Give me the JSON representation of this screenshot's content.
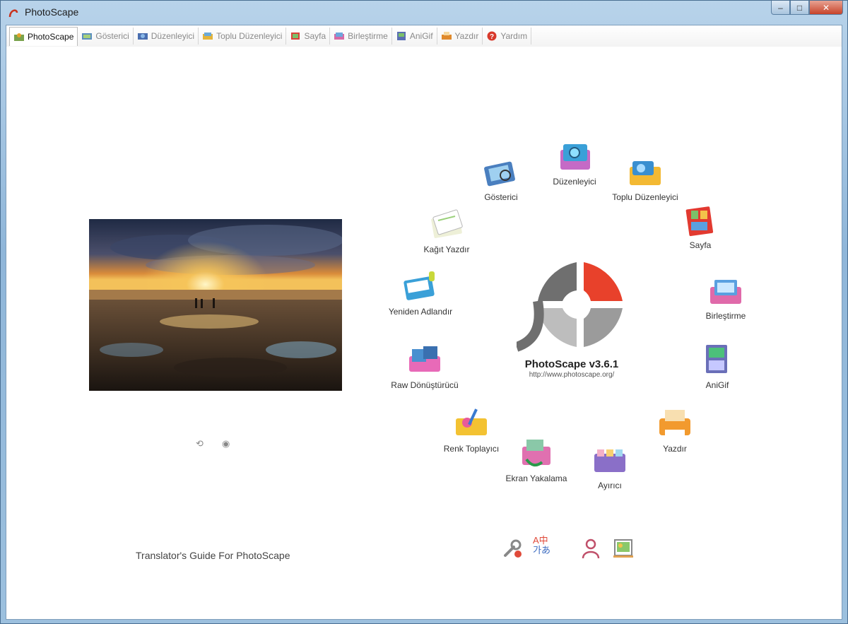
{
  "window": {
    "title": "PhotoScape",
    "controls": {
      "minimize": "–",
      "maximize": "□",
      "close": "✕"
    }
  },
  "tabs": [
    {
      "label": "PhotoScape",
      "active": true,
      "icon": "photoscape-icon"
    },
    {
      "label": "Gösterici",
      "active": false,
      "icon": "viewer-icon"
    },
    {
      "label": "Düzenleyici",
      "active": false,
      "icon": "editor-icon"
    },
    {
      "label": "Toplu Düzenleyici",
      "active": false,
      "icon": "batch-editor-icon"
    },
    {
      "label": "Sayfa",
      "active": false,
      "icon": "page-icon"
    },
    {
      "label": "Birleştirme",
      "active": false,
      "icon": "combine-icon"
    },
    {
      "label": "AniGif",
      "active": false,
      "icon": "anigif-icon"
    },
    {
      "label": "Yazdır",
      "active": false,
      "icon": "print-icon"
    },
    {
      "label": "Yardım",
      "active": false,
      "icon": "help-icon"
    }
  ],
  "brand": {
    "name": "PhotoScape v3.6.1",
    "url": "http://www.photoscape.org/"
  },
  "tools": {
    "gosterici": "Gösterici",
    "duzenleyici": "Düzenleyici",
    "toplu": "Toplu Düzenleyici",
    "sayfa": "Sayfa",
    "birlestirme": "Birleştirme",
    "anigif": "AniGif",
    "yazdir": "Yazdır",
    "ayirici": "Ayırıcı",
    "ekran": "Ekran Yakalama",
    "renk": "Renk Toplayıcı",
    "raw": "Raw Dönüştürücü",
    "yeniden": "Yeniden Adlandır",
    "kagit": "Kağıt Yazdır"
  },
  "guide_link": "Translator's Guide For PhotoScape",
  "language_icon_text": {
    "a": "A",
    "b": "中",
    "c": "가",
    "d": "あ"
  }
}
